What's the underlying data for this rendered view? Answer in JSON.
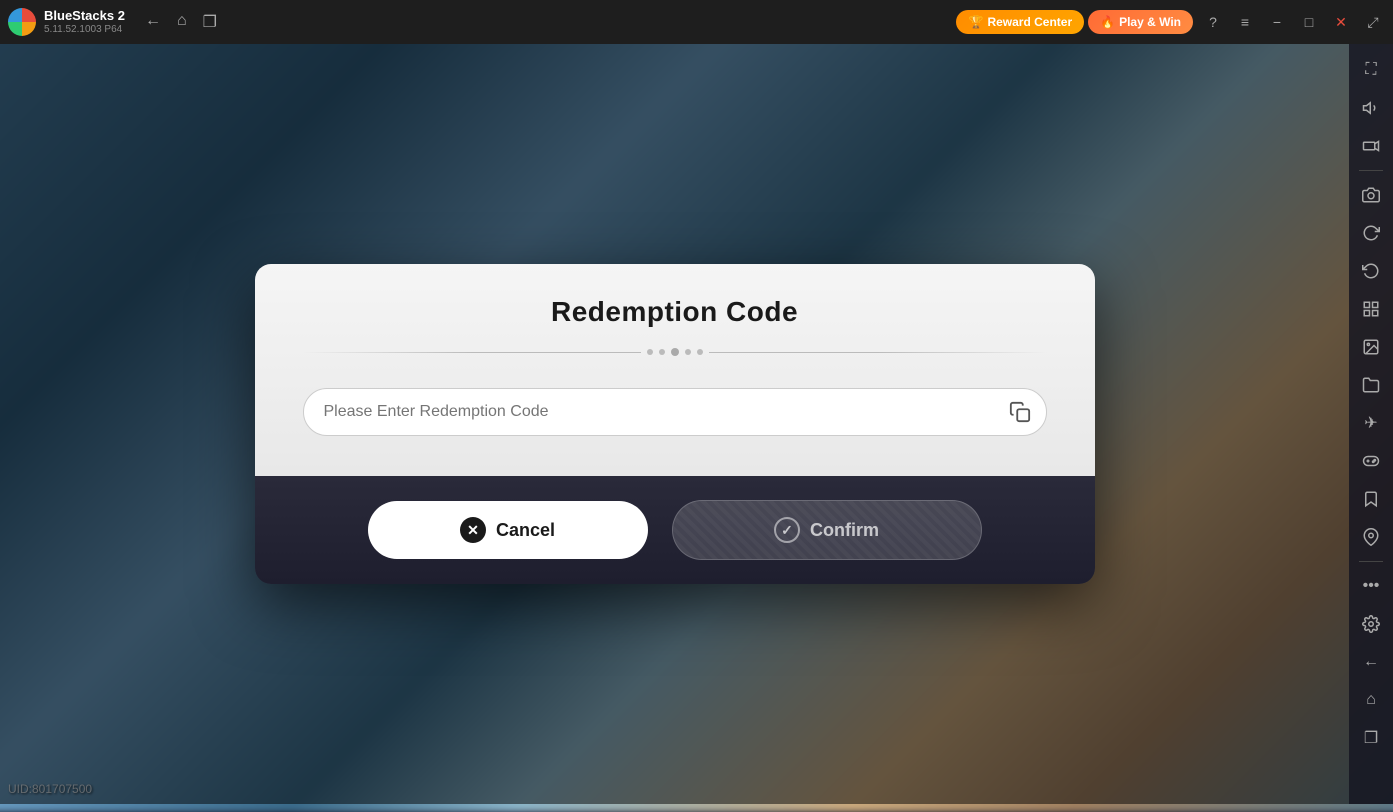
{
  "app": {
    "name": "BlueStacks 2",
    "version": "5.11.52.1003  P64"
  },
  "topbar": {
    "reward_label": "Reward Center",
    "play_win_label": "Play & Win",
    "reward_emoji": "🏆",
    "play_emoji": "🔥"
  },
  "nav": {
    "back_label": "←",
    "home_label": "⌂",
    "window_label": "❐"
  },
  "window_controls": {
    "help": "?",
    "menu": "≡",
    "minimize": "−",
    "maximize": "□",
    "close": "✕",
    "expand": "⤢"
  },
  "sidebar": {
    "icons": [
      {
        "name": "fullscreen-icon",
        "glyph": "⛶"
      },
      {
        "name": "volume-icon",
        "glyph": "🔊"
      },
      {
        "name": "video-icon",
        "glyph": "▶"
      },
      {
        "name": "screenshot-icon",
        "glyph": "📷"
      },
      {
        "name": "refresh-icon",
        "glyph": "↺"
      },
      {
        "name": "rotate-icon",
        "glyph": "⟳"
      },
      {
        "name": "apps-icon",
        "glyph": "⊞"
      },
      {
        "name": "media-icon",
        "glyph": "🖼"
      },
      {
        "name": "camera-icon",
        "glyph": "📸"
      },
      {
        "name": "folder-icon",
        "glyph": "📁"
      },
      {
        "name": "airplane-icon",
        "glyph": "✈"
      },
      {
        "name": "gamepad-icon",
        "glyph": "🎮"
      },
      {
        "name": "bookmark-icon",
        "glyph": "🔖"
      },
      {
        "name": "location-icon",
        "glyph": "📍"
      },
      {
        "name": "more-icon",
        "glyph": "•••"
      },
      {
        "name": "settings-icon",
        "glyph": "⚙"
      },
      {
        "name": "back-icon",
        "glyph": "←"
      },
      {
        "name": "home-icon",
        "glyph": "⌂"
      },
      {
        "name": "copy-icon",
        "glyph": "❐"
      }
    ]
  },
  "uid": {
    "label": "UID:801707500"
  },
  "modal": {
    "title": "Redemption Code",
    "input_placeholder": "Please Enter Redemption Code",
    "cancel_label": "Cancel",
    "confirm_label": "Confirm"
  }
}
